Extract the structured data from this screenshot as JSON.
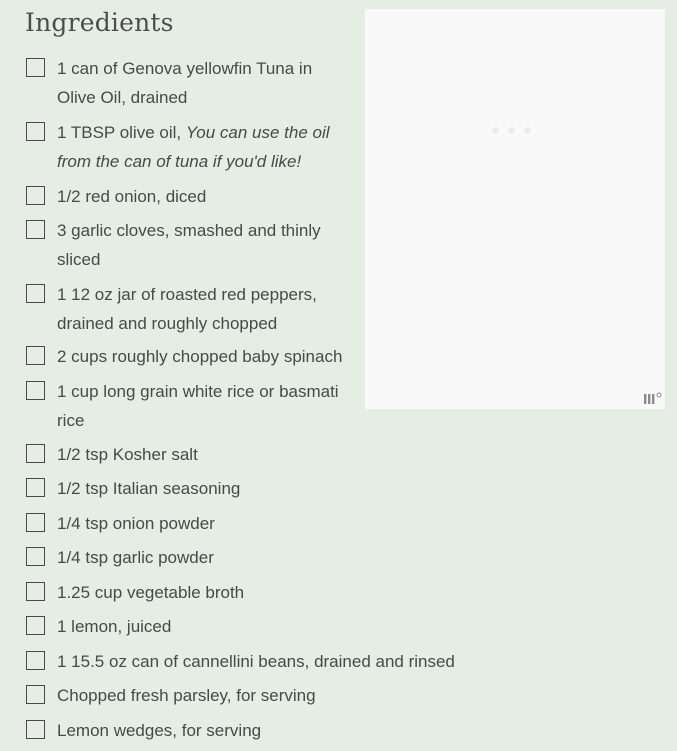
{
  "heading": "Ingredients",
  "ingredients": [
    {
      "lines": [
        "1 can of Genova yellowfin Tuna in",
        "Olive Oil, drained"
      ]
    },
    {
      "text": "1 TBSP olive oil,",
      "note_lines": [
        "You can use the oil",
        "from the can of tuna if you'd like!"
      ]
    },
    {
      "lines": [
        "1/2 red onion, diced"
      ]
    },
    {
      "lines": [
        "3 garlic cloves, smashed and thinly",
        "sliced"
      ]
    },
    {
      "lines": [
        "1 12 oz jar of roasted red peppers,",
        "drained and roughly chopped"
      ]
    },
    {
      "lines": [
        "2 cups roughly chopped baby spinach"
      ]
    },
    {
      "lines": [
        "1 cup long grain white rice or basmati",
        "rice"
      ]
    },
    {
      "lines": [
        "1/2 tsp Kosher salt"
      ]
    },
    {
      "lines": [
        "1/2 tsp Italian seasoning"
      ]
    },
    {
      "lines": [
        "1/4 tsp onion powder"
      ]
    },
    {
      "lines": [
        "1/4 tsp garlic powder"
      ]
    },
    {
      "lines": [
        "1.25 cup vegetable broth"
      ]
    },
    {
      "lines": [
        "1 lemon, juiced"
      ]
    },
    {
      "lines": [
        "1 15.5 oz can of cannellini beans, drained and rinsed"
      ]
    },
    {
      "lines": [
        "Chopped fresh parsley, for serving"
      ]
    },
    {
      "lines": [
        "Lemon wedges, for serving"
      ]
    }
  ],
  "ad": {
    "logo_icon": "mediavine-logo-icon",
    "loading_icon": "loading-dots-icon"
  }
}
